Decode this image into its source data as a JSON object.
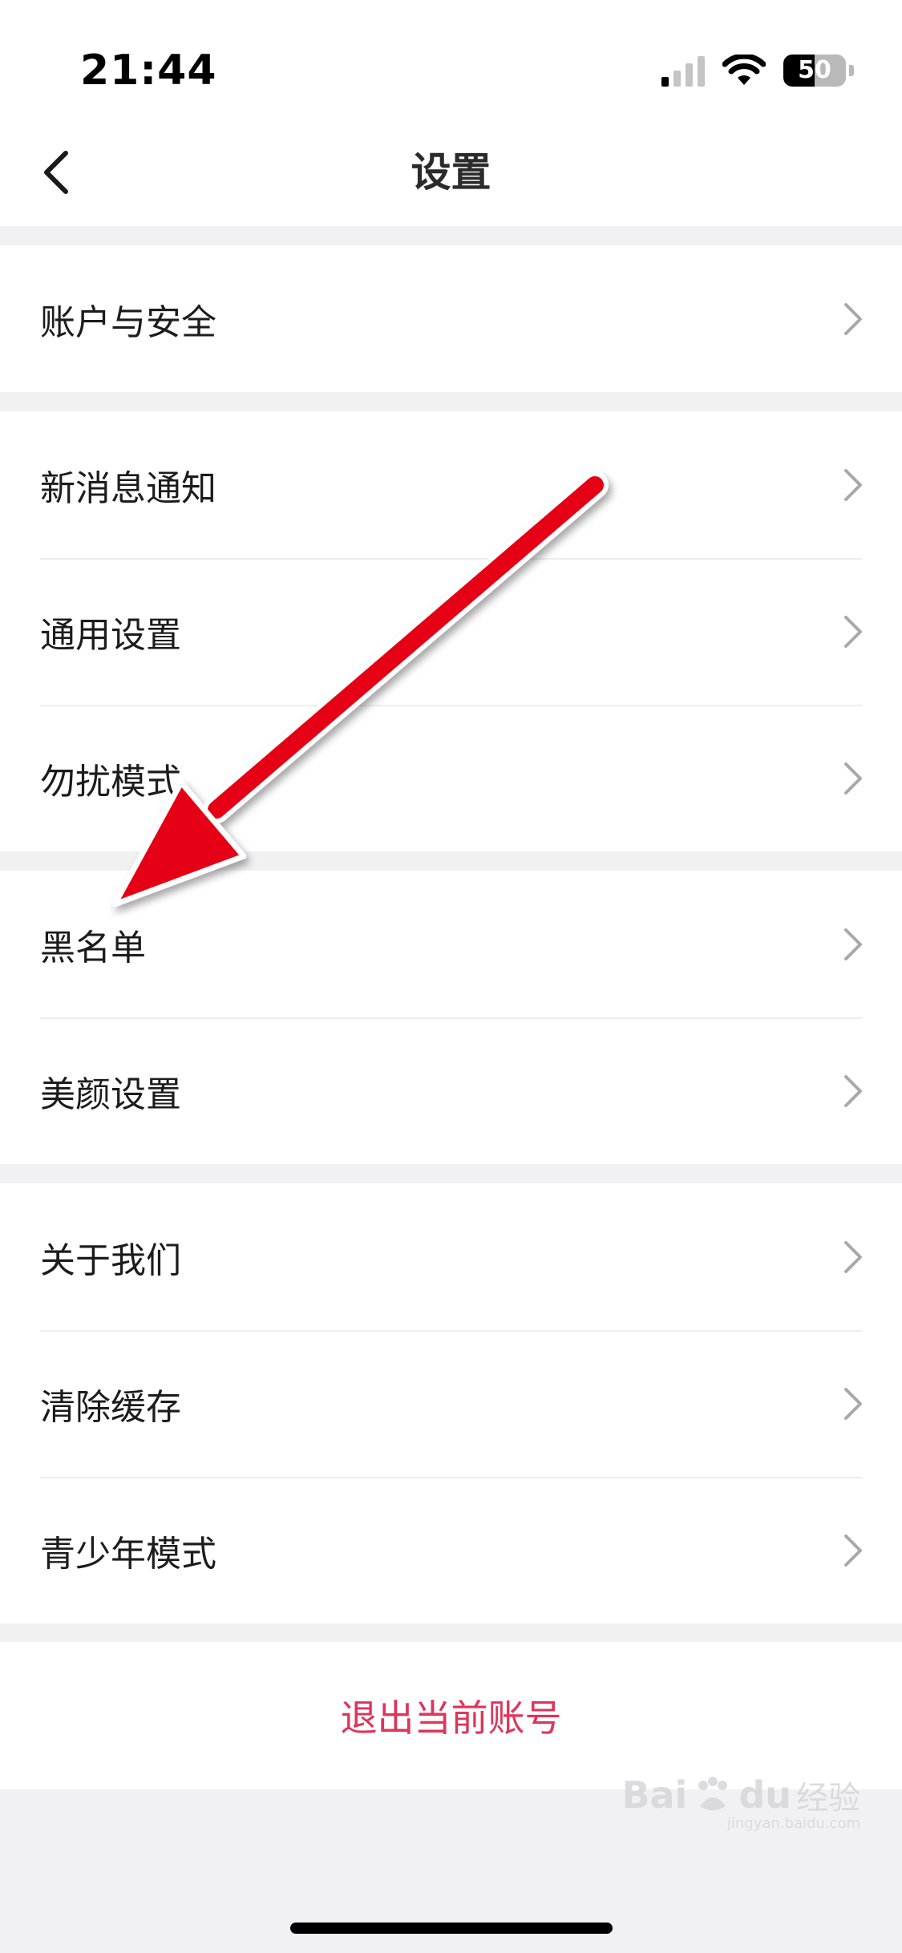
{
  "status_bar": {
    "time": "21:44",
    "battery_level": "50",
    "battery_fraction": 0.5,
    "icons": [
      "cellular-signal-icon",
      "wifi-icon",
      "battery-icon"
    ]
  },
  "nav": {
    "back_icon": "chevron-left-icon",
    "title": "设置"
  },
  "groups": [
    {
      "items": [
        {
          "label": "账户与安全"
        }
      ]
    },
    {
      "items": [
        {
          "label": "新消息通知"
        },
        {
          "label": "通用设置"
        },
        {
          "label": "勿扰模式"
        }
      ]
    },
    {
      "items": [
        {
          "label": "黑名单"
        },
        {
          "label": "美颜设置"
        }
      ]
    },
    {
      "items": [
        {
          "label": "关于我们"
        },
        {
          "label": "清除缓存"
        },
        {
          "label": "青少年模式"
        }
      ]
    }
  ],
  "logout": {
    "label": "退出当前账号"
  },
  "colors": {
    "background": "#f1f1f3",
    "accent_logout": "#e0345a",
    "annotation_arrow": "#e60012"
  },
  "watermark": {
    "brand": "Bai",
    "paw": "du",
    "cn": "经验",
    "sub": "jingyan.baidu.com"
  }
}
